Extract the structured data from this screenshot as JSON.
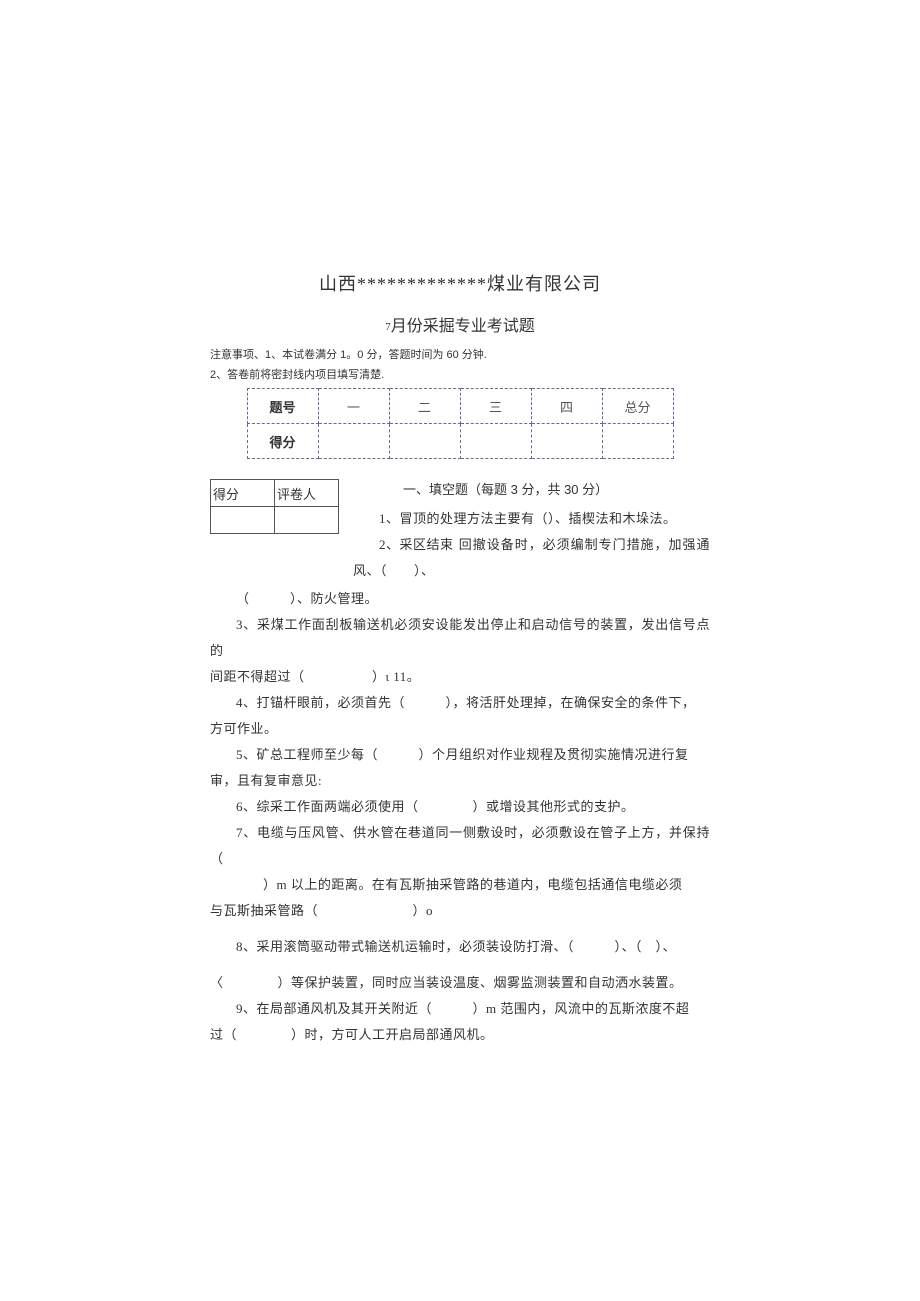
{
  "title_main": "山西*************煤业有限公司",
  "title_sub_prefix": "7",
  "title_sub_rest": "月份采掘专业考试题",
  "notes": {
    "line1_label": "注意事项、",
    "line1_item": "1、本试卷满分 1。0 分，答题时间为 60 分钟.",
    "line2": "2、答卷前将密封线内项目填写清楚."
  },
  "score_table": {
    "col1": "题号",
    "cols": [
      "一",
      "二",
      "三",
      "四",
      "总分"
    ],
    "row2_label": "得分"
  },
  "mini": {
    "c1": "得分",
    "c2": "评卷人"
  },
  "section1_title": "一、填空题（每题 3 分，共 30 分）",
  "q1": "1、冒顶的处理方法主要有（）、插楔法和木垛法。",
  "q2a": "2、采区结束",
  "q2b": "回撤设备时，必须编制专门措施，加强通风、（　　）、",
  "q2c": "（　　　）、防火管理。",
  "q3a": "3、采煤工作面刮板输送机必须安设能发出停止和启动信号的装置，发出信号点的",
  "q3b": "间距不得超过（　　　　　）ι 11。",
  "q4a": "4、打锚杆眼前，必须首先（　　　），将活肝处理掉，在确保安全的条件下，",
  "q4b": "方可作业。",
  "q5a": "5、矿总工程师至少每（　　　）个月组织对作业规程及贯彻实施情况进行复",
  "q5b": "审，且有复审意见:",
  "q6": "6、综采工作面两端必须使用（　　　　）或增设其他形式的支护。",
  "q7a": "7、电缆与压风管、供水管在巷道同一侧敷设时，必须敷设在管子上方，并保持（",
  "q7b": "　　）m 以上的距离。在有瓦斯抽采管路的巷道内，电缆包括通信电缆必须",
  "q7c": "与瓦斯抽采管路（　　　　　　　）o",
  "q8a": "8、采用滚筒驱动带式输送机运输时，必须装设防打滑、（　　　）、（　）、",
  "q8b": "〈　　　　）等保护装置，同时应当装设温度、烟雾监测装置和自动洒水装置。",
  "q9a": "9、在局部通风机及其开关附近（　　　）m 范围内，风流中的瓦斯浓度不超",
  "q9b": "过（　　　　）时，方可人工开启局部通风机。"
}
